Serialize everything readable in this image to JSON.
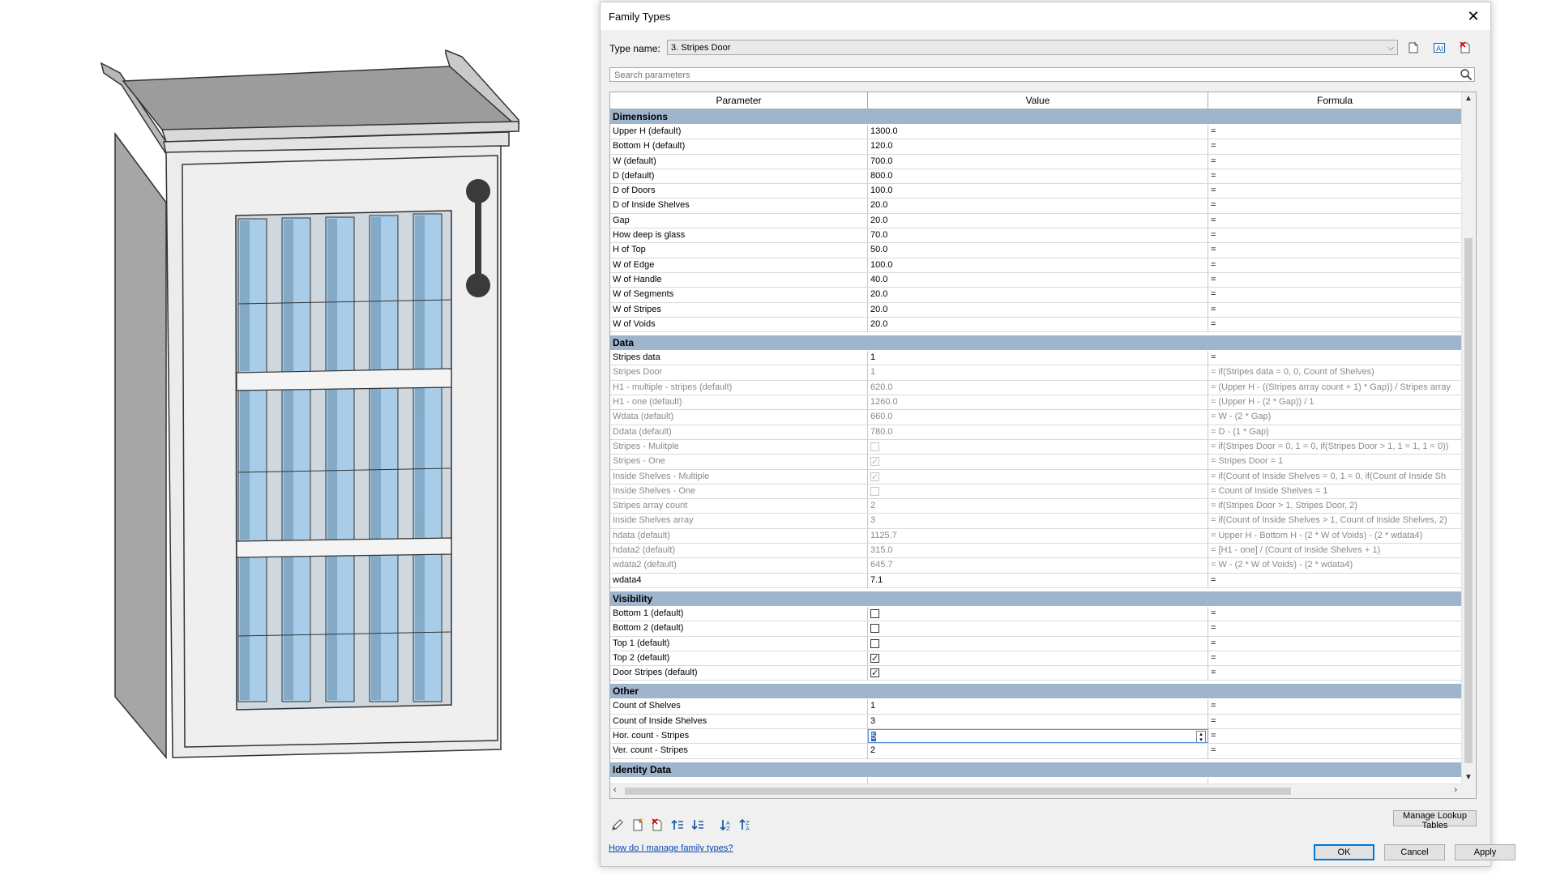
{
  "dialog": {
    "title": "Family Types",
    "type_name_label": "Type name:",
    "type_name_value": "3. Stripes Door",
    "search_placeholder": "Search parameters",
    "headers": [
      "Parameter",
      "Value",
      "Formula"
    ],
    "groups": [
      {
        "name": "Dimensions",
        "rows": [
          {
            "p": "Upper H (default)",
            "v": "1300.0",
            "f": "="
          },
          {
            "p": "Bottom H (default)",
            "v": "120.0",
            "f": "="
          },
          {
            "p": "W (default)",
            "v": "700.0",
            "f": "="
          },
          {
            "p": "D (default)",
            "v": "800.0",
            "f": "="
          },
          {
            "p": "D of Doors",
            "v": "100.0",
            "f": "="
          },
          {
            "p": "D of Inside Shelves",
            "v": "20.0",
            "f": "="
          },
          {
            "p": "Gap",
            "v": "20.0",
            "f": "="
          },
          {
            "p": "How deep is glass",
            "v": "70.0",
            "f": "="
          },
          {
            "p": "H of Top",
            "v": "50.0",
            "f": "="
          },
          {
            "p": "W of Edge",
            "v": "100.0",
            "f": "="
          },
          {
            "p": "W of Handle",
            "v": "40.0",
            "f": "="
          },
          {
            "p": "W of Segments",
            "v": "20.0",
            "f": "="
          },
          {
            "p": "W of Stripes",
            "v": "20.0",
            "f": "="
          },
          {
            "p": "W of Voids",
            "v": "20.0",
            "f": "="
          }
        ]
      },
      {
        "name": "Data",
        "rows": [
          {
            "p": "Stripes data",
            "v": "1",
            "f": "="
          },
          {
            "p": "Stripes Door",
            "v": "1",
            "f": "= if(Stripes data = 0, 0, Count of Shelves)",
            "dim": true
          },
          {
            "p": "H1 - multiple - stripes (default)",
            "v": "620.0",
            "f": "= (Upper H - ((Stripes array count + 1) * Gap)) / Stripes array",
            "dim": true
          },
          {
            "p": "H1 - one (default)",
            "v": "1260.0",
            "f": "= (Upper H - (2 * Gap)) / 1",
            "dim": true
          },
          {
            "p": "Wdata (default)",
            "v": "660.0",
            "f": "= W - (2 * Gap)",
            "dim": true
          },
          {
            "p": "Ddata (default)",
            "v": "780.0",
            "f": "= D - (1 * Gap)",
            "dim": true
          },
          {
            "p": "Stripes - Mulitple",
            "check": false,
            "f": "= if(Stripes Door = 0, 1 = 0, if(Stripes Door > 1, 1 = 1, 1 = 0))",
            "dim": true
          },
          {
            "p": "Stripes - One",
            "check": true,
            "f": "= Stripes Door = 1",
            "dim": true
          },
          {
            "p": "Inside Shelves - Multiple",
            "check": true,
            "f": "= if(Count of Inside Shelves = 0, 1 = 0, if(Count of Inside Sh",
            "dim": true
          },
          {
            "p": "Inside Shelves - One",
            "check": false,
            "f": "= Count of Inside Shelves = 1",
            "dim": true
          },
          {
            "p": "Stripes array count",
            "v": "2",
            "f": "= if(Stripes Door > 1, Stripes Door, 2)",
            "dim": true
          },
          {
            "p": "Inside Shelves array",
            "v": "3",
            "f": "= if(Count of Inside Shelves > 1, Count of Inside Shelves, 2)",
            "dim": true
          },
          {
            "p": "hdata (default)",
            "v": "1125.7",
            "f": "= Upper H - Bottom H - (2 * W of Voids) - (2 * wdata4)",
            "dim": true
          },
          {
            "p": "hdata2 (default)",
            "v": "315.0",
            "f": "= [H1 - one] / (Count of Inside Shelves + 1)",
            "dim": true
          },
          {
            "p": "wdata2 (default)",
            "v": "645.7",
            "f": "= W - (2 * W of Voids) - (2 * wdata4)",
            "dim": true
          },
          {
            "p": "wdata4",
            "v": "7.1",
            "f": "="
          }
        ]
      },
      {
        "name": "Visibility",
        "rows": [
          {
            "p": "Bottom 1 (default)",
            "check": false,
            "f": "="
          },
          {
            "p": "Bottom 2 (default)",
            "check": false,
            "f": "="
          },
          {
            "p": "Top 1 (default)",
            "check": false,
            "f": "="
          },
          {
            "p": "Top 2 (default)",
            "check": true,
            "f": "="
          },
          {
            "p": "Door Stripes (default)",
            "check": true,
            "f": "="
          }
        ]
      },
      {
        "name": "Other",
        "rows": [
          {
            "p": "Count of Shelves",
            "v": "1",
            "f": "="
          },
          {
            "p": "Count of Inside Shelves",
            "v": "3",
            "f": "="
          },
          {
            "p": "Hor. count - Stripes",
            "v": "5",
            "f": "=",
            "active": true
          },
          {
            "p": "Ver. count - Stripes",
            "v": "2",
            "f": "="
          }
        ]
      },
      {
        "name": "Identity Data",
        "rows": [
          {
            "p": "",
            "v": "",
            "f": ""
          }
        ]
      }
    ],
    "help_link": "How do I manage family types?",
    "manage_lookup": "Manage Lookup Tables",
    "ok": "OK",
    "cancel": "Cancel",
    "apply": "Apply"
  },
  "colors": {
    "group_header": "#9fb5ce",
    "glass": "#a9cde8",
    "link": "#0645ad"
  }
}
